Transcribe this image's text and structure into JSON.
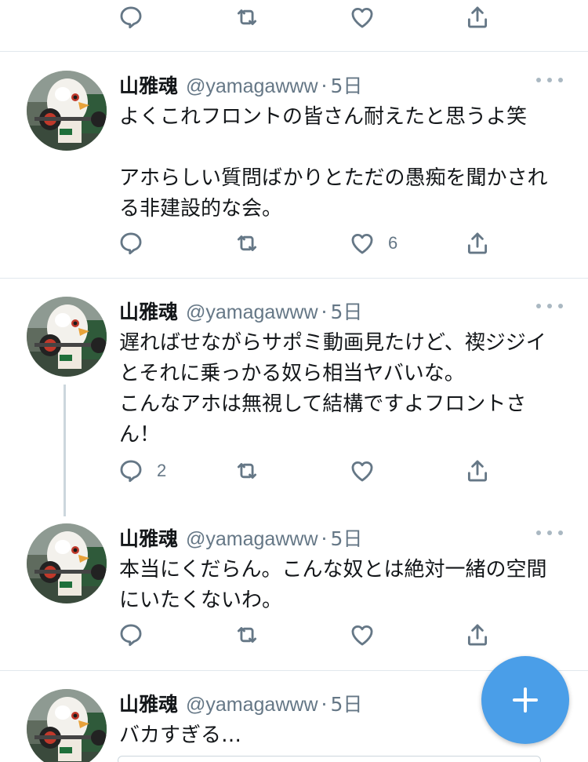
{
  "colors": {
    "accent": "#4a9ee8",
    "muted": "#657786",
    "divider": "#e1e8ed",
    "text": "#14171a"
  },
  "top_actions": {
    "reply_count": "",
    "retweet_count": "",
    "like_count": ""
  },
  "tweets": [
    {
      "name": "山雅魂",
      "handle": "@yamagawww",
      "separator": "·",
      "time": "5日",
      "text": "よくこれフロントの皆さん耐えたと思うよ笑\n\nアホらしい質問ばかりとただの愚痴を聞かされる非建設的な会。",
      "reply_count": "",
      "retweet_count": "",
      "like_count": "6"
    },
    {
      "name": "山雅魂",
      "handle": "@yamagawww",
      "separator": "·",
      "time": "5日",
      "text": "遅ればせながらサポミ動画見たけど、禊ジジイとそれに乗っかる奴ら相当ヤバいな。\nこんなアホは無視して結構ですよフロントさん！",
      "reply_count": "2",
      "retweet_count": "",
      "like_count": ""
    },
    {
      "name": "山雅魂",
      "handle": "@yamagawww",
      "separator": "·",
      "time": "5日",
      "text": "本当にくだらん。こんな奴とは絶対一緒の空間にいたくないわ。",
      "reply_count": "",
      "retweet_count": "",
      "like_count": ""
    },
    {
      "name": "山雅魂",
      "handle": "@yamagawww",
      "separator": "·",
      "time": "5日",
      "text": "バカすぎる…"
    }
  ],
  "icons": {
    "reply": "reply-icon",
    "retweet": "retweet-icon",
    "like": "heart-icon",
    "share": "share-icon",
    "more": "more-icon",
    "compose": "plus-icon"
  }
}
